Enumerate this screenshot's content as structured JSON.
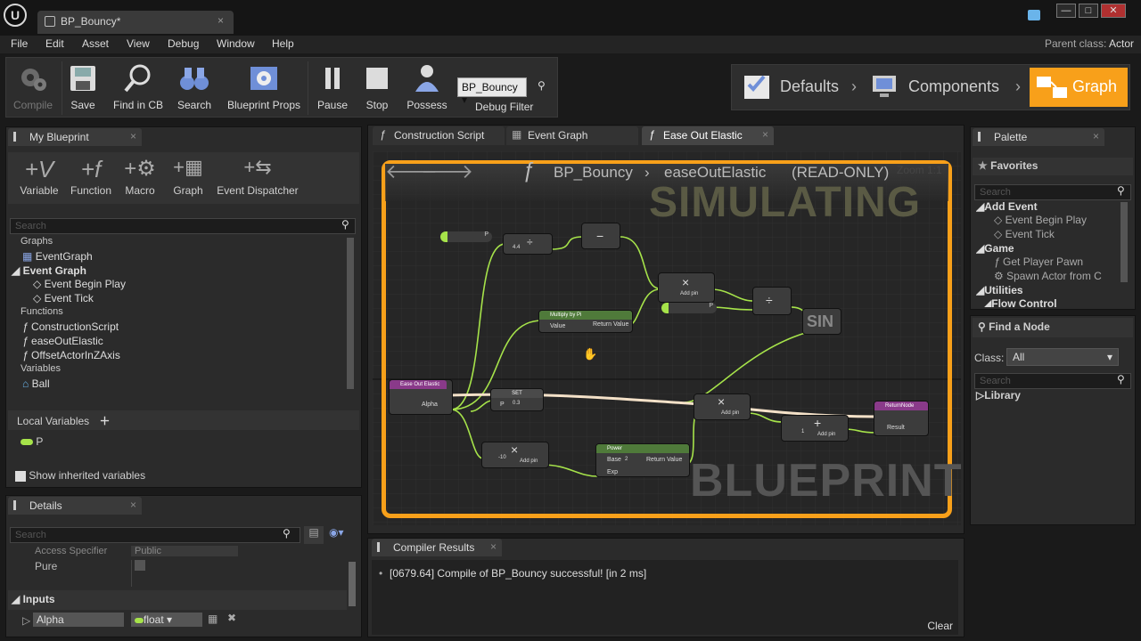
{
  "titlebar": {
    "logo": "U",
    "tab_title": "BP_Bouncy*",
    "close": "×",
    "minimize": "—",
    "maximize": "□",
    "window_close": "✕"
  },
  "menu": {
    "items": [
      "File",
      "Edit",
      "Asset",
      "View",
      "Debug",
      "Window",
      "Help"
    ],
    "parent_class_label": "Parent class:",
    "parent_class_value": "Actor"
  },
  "toolbar": {
    "compile": "Compile",
    "save": "Save",
    "find_in_cb": "Find in CB",
    "search": "Search",
    "blueprint_props": "Blueprint Props",
    "pause": "Pause",
    "stop": "Stop",
    "possess": "Possess",
    "debug_value": "BP_Bouncy",
    "debug_filter": "Debug Filter"
  },
  "modes": {
    "defaults": "Defaults",
    "components": "Components",
    "graph": "Graph"
  },
  "my_blueprint": {
    "title": "My Blueprint",
    "add_buttons": [
      "Variable",
      "Function",
      "Macro",
      "Graph",
      "Event Dispatcher"
    ],
    "search_placeholder": "Search",
    "graphs_header": "Graphs",
    "event_graph": "EventGraph",
    "event_graph_cat": "Event Graph",
    "event_begin_play": "Event Begin Play",
    "event_tick": "Event Tick",
    "functions_header": "Functions",
    "functions": [
      "ConstructionScript",
      "easeOutElastic",
      "OffsetActorInZAxis"
    ],
    "variables_header": "Variables",
    "ball": "Ball",
    "local_vars": "Local Variables",
    "local_var_p": "P",
    "show_inherited": "Show inherited variables"
  },
  "details": {
    "title": "Details",
    "search_placeholder": "Search",
    "access_specifier": "Access Specifier",
    "access_value": "Public",
    "pure": "Pure",
    "inputs": "Inputs",
    "alpha": "Alpha",
    "float": "float"
  },
  "tabs": {
    "construction_script": "Construction Script",
    "event_graph": "Event Graph",
    "ease_out_elastic": "Ease Out Elastic"
  },
  "graph": {
    "breadcrumb_bp": "BP_Bouncy",
    "breadcrumb_fn": "easeOutElastic",
    "read_only": "(READ-ONLY)",
    "zoom": "Zoom 1:1",
    "simulating": "SIMULATING",
    "watermark": "BLUEPRINT",
    "nodes": {
      "multiply_by_pi": "Multiply by Pi",
      "value": "Value",
      "return_value": "Return Value",
      "ease_out_elastic": "Ease Out Elastic",
      "alpha": "Alpha",
      "set": "SET",
      "p": "P",
      "power": "Power",
      "base": "Base",
      "exp": "Exp",
      "return_node": "ReturnNode",
      "result": "Result",
      "sin": "SIN",
      "add_pin": "Add pin",
      "v_44": "4.4",
      "v_2": "2",
      "v_03": "0.3",
      "v_neg10": "-10",
      "v_1": "1",
      "v_2b": "2"
    }
  },
  "palette": {
    "title": "Palette",
    "favorites": "Favorites",
    "search_placeholder": "Search",
    "add_event": "Add Event",
    "event_begin_play": "Event Begin Play",
    "event_tick": "Event Tick",
    "game": "Game",
    "get_player_pawn": "Get Player Pawn",
    "spawn_actor": "Spawn Actor from C",
    "utilities": "Utilities",
    "flow_control": "Flow Control",
    "find_node": "Find a Node",
    "class_label": "Class:",
    "class_value": "All",
    "library": "Library"
  },
  "compiler": {
    "title": "Compiler Results",
    "message": "[0679.64] Compile of BP_Bouncy successful! [in 2 ms]",
    "clear": "Clear"
  },
  "colors": {
    "accent": "#f8a01a",
    "exec_wire": "#e8e8e8",
    "float_wire": "#a6e34a",
    "graph_bg": "#262626"
  }
}
